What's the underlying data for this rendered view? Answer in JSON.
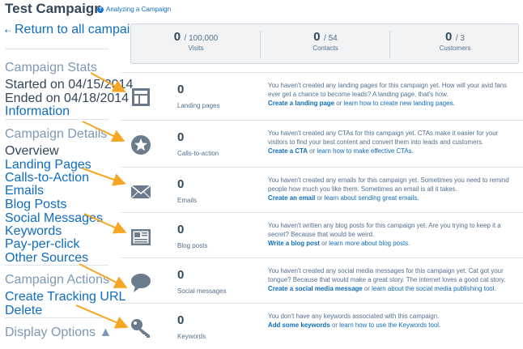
{
  "header": {
    "title": "Test Campaign",
    "help_link": "Analyzing a Campaign"
  },
  "sidebar": {
    "back_link": "Return to all campaigns",
    "stats_heading": "Campaign Stats",
    "started": "Started on 04/15/2014",
    "ended": "Ended on 04/18/2014",
    "information": "Information",
    "details_heading": "Campaign Details",
    "details_items": [
      "Overview",
      "Landing Pages",
      "Calls-to-Action",
      "Emails",
      "Blog Posts",
      "Social Messages",
      "Keywords",
      "Pay-per-click",
      "Other Sources"
    ],
    "actions_heading": "Campaign Actions",
    "actions_items": [
      "Create Tracking URL",
      "Delete"
    ],
    "display_options": "Display Options ▲"
  },
  "stats": [
    {
      "value": "0",
      "total": "/ 100,000",
      "label": "Visits"
    },
    {
      "value": "0",
      "total": "/ 54",
      "label": "Contacts"
    },
    {
      "value": "0",
      "total": "/ 3",
      "label": "Customers"
    }
  ],
  "rows": [
    {
      "icon": "landing-page-icon",
      "count": "0",
      "label": "Landing pages",
      "desc_html": "You haven't created any landing pages for this campaign yet. How will your avid fans ever get a chance to become leads? A landing page, that's how.",
      "action": "Create a landing page",
      "or": " or ",
      "learn": "learn how to create new landing pages."
    },
    {
      "icon": "cta-star-icon",
      "count": "0",
      "label": "Calls-to-action",
      "desc_html": "You haven't created any CTAs for this campaign yet. CTAs make it easier for your visitors to find your best content and convert them into leads and customers.",
      "action": "Create a CTA",
      "or": " or ",
      "learn": "learn how to make effective CTAs."
    },
    {
      "icon": "email-envelope-icon",
      "count": "0",
      "label": "Emails",
      "desc_html": "You haven't created any emails for this campaign yet. Sometimes you need to remind people how much you like them. Sometimes an email is all it takes.",
      "action": "Create an email",
      "or": " or ",
      "learn": "learn about sending great emails."
    },
    {
      "icon": "blog-post-icon",
      "count": "0",
      "label": "Blog posts",
      "desc_html": "You haven't written any blog posts for this campaign yet. Are you trying to keep it a secret? Because that would be weird.",
      "action": "Write a blog post",
      "or": " or ",
      "learn": "learn more about blog posts."
    },
    {
      "icon": "social-bubble-icon",
      "count": "0",
      "label": "Social messages",
      "desc_html": "You haven't created any social media messages for this campaign yet. Cat got your tongue? Because that would make a great story. The internet loves a good cat story.",
      "action": "Create a social media message",
      "or": " or ",
      "learn": "learn about the social media publishing tool."
    },
    {
      "icon": "keyword-key-icon",
      "count": "0",
      "label": "Keywords",
      "desc_html": "You don't have any keywords associated with this campaign.",
      "action": "Add some keywords",
      "or": " or ",
      "learn": "learn how to use the Keywords tool."
    }
  ],
  "colors": {
    "accent": "#0f6cbf",
    "arrow": "#f5a623",
    "icon": "#6b7b8c"
  }
}
